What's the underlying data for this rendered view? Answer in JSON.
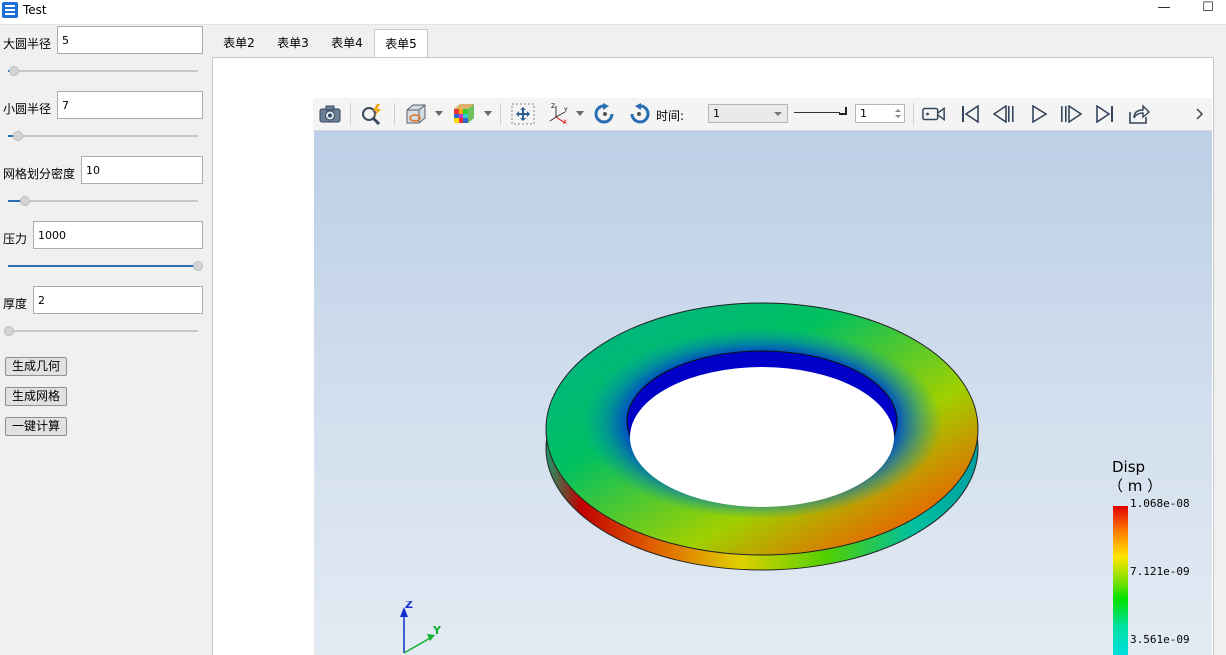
{
  "window": {
    "title": "Test",
    "minimize_glyph": "—",
    "maximize_glyph": "☐"
  },
  "params": {
    "r_big": {
      "label": "大圆半径",
      "value": "5",
      "slider_fraction": 0.03
    },
    "r_small": {
      "label": "小圆半径",
      "value": "7",
      "slider_fraction": 0.05
    },
    "mesh_density": {
      "label": "网格划分密度",
      "value": "10",
      "slider_fraction": 0.09
    },
    "pressure": {
      "label": "压力",
      "value": "1000",
      "slider_fraction": 1.0
    },
    "thickness": {
      "label": "厚度",
      "value": "2",
      "slider_fraction": 0.0
    }
  },
  "buttons": {
    "gen_geometry": "生成几何",
    "gen_mesh": "生成网格",
    "compute": "一键计算"
  },
  "tabs": [
    "表单2",
    "表单3",
    "表单4",
    "表单5"
  ],
  "active_tab": "表单5",
  "toolbar": {
    "time_label": "时间:",
    "time_value": "1",
    "frame_value": "1"
  },
  "legend": {
    "title": "Disp",
    "unit": "（ m ）",
    "max": "1.068e-08",
    "mid": "7.121e-09",
    "low": "3.561e-09"
  },
  "axes": {
    "z": "Z",
    "y": "Y"
  },
  "colors": {
    "accent": "#2a6fb3",
    "mesh_blue": "#0000c8",
    "background_top": "#bccfe6"
  },
  "icons": [
    "app-icon",
    "camera-icon",
    "zoom-icon",
    "box-icon",
    "color-cube-icon",
    "move-icon",
    "axes-icon",
    "rotate-left-icon",
    "rotate-right-icon",
    "video-camera-icon",
    "first-frame-icon",
    "prev-frame-icon",
    "play-icon",
    "next-frame-icon",
    "last-frame-icon",
    "export-icon"
  ]
}
